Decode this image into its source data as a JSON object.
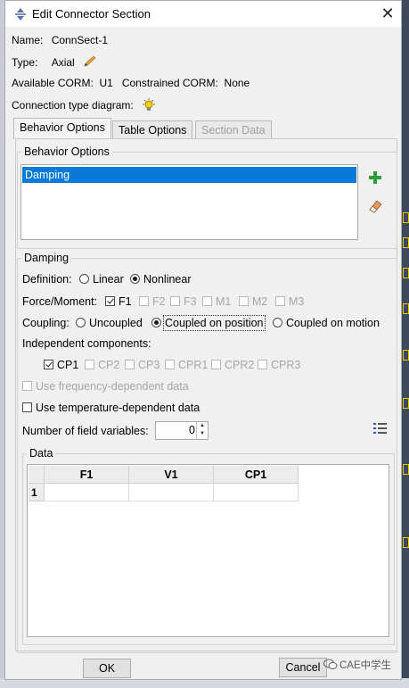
{
  "window": {
    "title": "Edit Connector Section"
  },
  "info": {
    "name_label": "Name:",
    "name_value": "ConnSect-1",
    "type_label": "Type:",
    "type_value": "Axial",
    "corm_text": "Available CORM:  U1   Constrained CORM:  None",
    "diagram_label": "Connection type diagram:"
  },
  "tabs": [
    {
      "label": "Behavior Options",
      "state": "active"
    },
    {
      "label": "Table Options",
      "state": "normal"
    },
    {
      "label": "Section Data",
      "state": "disabled"
    }
  ],
  "behavior_options": {
    "group_title": "Behavior Options",
    "items": [
      "Damping"
    ],
    "selected": "Damping"
  },
  "damping": {
    "group_title": "Damping",
    "definition_label": "Definition:",
    "definition_options": [
      {
        "label": "Linear",
        "selected": false
      },
      {
        "label": "Nonlinear",
        "selected": true
      }
    ],
    "force_moment_label": "Force/Moment:",
    "force_moment": [
      {
        "label": "F1",
        "checked": true,
        "enabled": true
      },
      {
        "label": "F2",
        "checked": false,
        "enabled": false
      },
      {
        "label": "F3",
        "checked": false,
        "enabled": false
      },
      {
        "label": "M1",
        "checked": false,
        "enabled": false
      },
      {
        "label": "M2",
        "checked": false,
        "enabled": false
      },
      {
        "label": "M3",
        "checked": false,
        "enabled": false
      }
    ],
    "coupling_label": "Coupling:",
    "coupling_options": [
      {
        "label": "Uncoupled",
        "selected": false
      },
      {
        "label": "Coupled on position",
        "selected": true
      },
      {
        "label": "Coupled on motion",
        "selected": false
      }
    ],
    "independent_label": "Independent components:",
    "independent": [
      {
        "label": "CP1",
        "checked": true,
        "enabled": true
      },
      {
        "label": "CP2",
        "checked": false,
        "enabled": false
      },
      {
        "label": "CP3",
        "checked": false,
        "enabled": false
      },
      {
        "label": "CPR1",
        "checked": false,
        "enabled": false
      },
      {
        "label": "CPR2",
        "checked": false,
        "enabled": false
      },
      {
        "label": "CPR3",
        "checked": false,
        "enabled": false
      }
    ],
    "use_frequency_label": "Use frequency-dependent data",
    "use_temperature_label": "Use temperature-dependent data",
    "field_vars_label": "Number of field variables:",
    "field_vars_value": "0"
  },
  "data_table": {
    "group_title": "Data",
    "columns": [
      "F1",
      "V1",
      "CP1"
    ],
    "rows": [
      {
        "index": "1",
        "cells": [
          "",
          "",
          ""
        ]
      }
    ]
  },
  "buttons": {
    "ok": "OK",
    "cancel": "Cancel"
  },
  "watermark": "CAE中学生",
  "colors": {
    "selection": "#0a7ad7",
    "add_icon": "#2e9c3a",
    "bulb": "#e8c800"
  }
}
